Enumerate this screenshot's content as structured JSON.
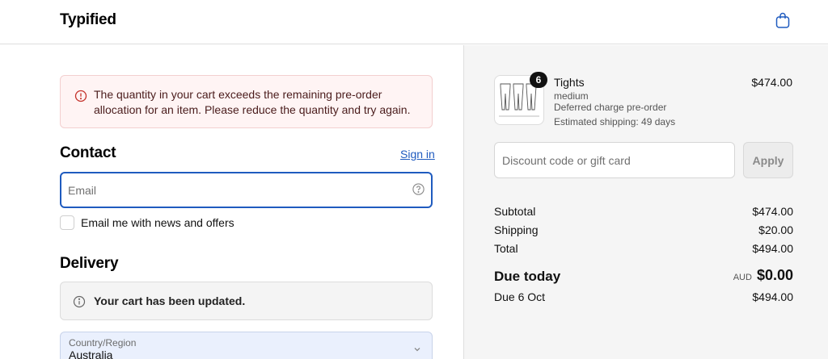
{
  "header": {
    "brand": "Typified",
    "cart_icon": "shopping-bag-icon",
    "accent_color": "#1f5bbf"
  },
  "checkout": {
    "error_banner": {
      "icon": "alert-circle-icon",
      "message": "The quantity in your cart exceeds the remaining pre-order allocation for an item. Please reduce the quantity and try again."
    },
    "contact": {
      "title": "Contact",
      "sign_in": "Sign in",
      "email_placeholder": "Email",
      "email_value": "",
      "help_icon": "help-circle-icon",
      "newsletter_label": "Email me with news and offers",
      "newsletter_checked": false
    },
    "delivery": {
      "title": "Delivery",
      "info_icon": "info-circle-icon",
      "info_message": "Your cart has been updated.",
      "country_label": "Country/Region",
      "country_value": "Australia"
    }
  },
  "summary": {
    "item": {
      "quantity": "6",
      "name": "Tights",
      "variant": "medium",
      "preorder": "Deferred charge pre-order",
      "shipping_estimate": "Estimated shipping: 49 days",
      "price": "$474.00"
    },
    "discount_placeholder": "Discount code or gift card",
    "apply_label": "Apply",
    "rows": {
      "subtotal_label": "Subtotal",
      "subtotal_value": "$474.00",
      "shipping_label": "Shipping",
      "shipping_value": "$20.00",
      "total_label": "Total",
      "total_value": "$494.00",
      "due_today_label": "Due today",
      "due_today_currency": "AUD",
      "due_today_value": "$0.00",
      "due_later_label": "Due 6 Oct",
      "due_later_value": "$494.00"
    }
  }
}
